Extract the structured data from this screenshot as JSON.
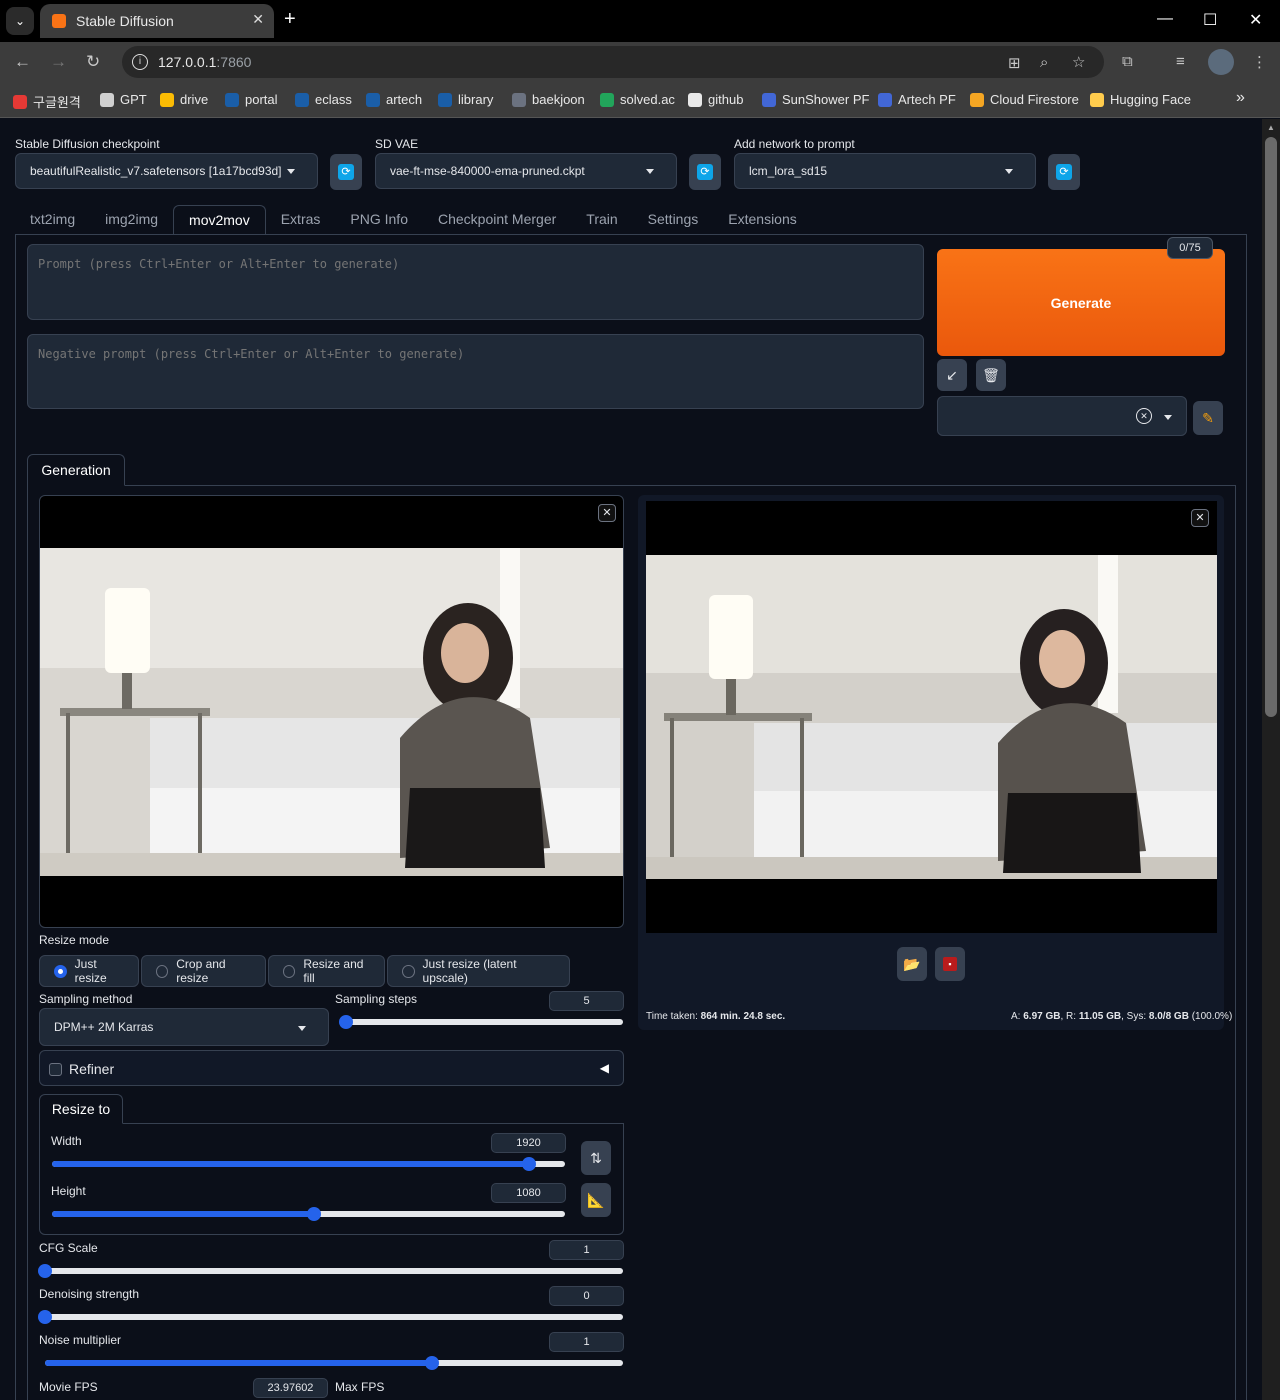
{
  "browser": {
    "tab_title": "Stable Diffusion",
    "url_host": "127.0.0.1",
    "url_port": ":7860",
    "bookmarks": [
      "구글원격",
      "GPT",
      "drive",
      "portal",
      "eclass",
      "artech",
      "library",
      "baekjoon",
      "solved.ac",
      "github",
      "SunShower PF",
      "Artech PF",
      "Cloud Firestore",
      "Hugging Face"
    ],
    "bookmark_colors": [
      "#e53935",
      "#d0d0d0",
      "#fbbc04",
      "#1a5ea8",
      "#1a5ea8",
      "#1a5ea8",
      "#1a5ea8",
      "#6b7280",
      "#22a55b",
      "#e8e8e8",
      "#4267d6",
      "#4267d6",
      "#f5a623",
      "#ffcc4d"
    ]
  },
  "settings": {
    "checkpoint_label": "Stable Diffusion checkpoint",
    "checkpoint_value": "beautifulRealistic_v7.safetensors [1a17bcd93d]",
    "vae_label": "SD VAE",
    "vae_value": "vae-ft-mse-840000-ema-pruned.ckpt",
    "network_label": "Add network to prompt",
    "network_value": "lcm_lora_sd15"
  },
  "tabs": [
    "txt2img",
    "img2img",
    "mov2mov",
    "Extras",
    "PNG Info",
    "Checkpoint Merger",
    "Train",
    "Settings",
    "Extensions"
  ],
  "active_tab": "mov2mov",
  "prompt": {
    "placeholder": "Prompt (press Ctrl+Enter or Alt+Enter to generate)",
    "negative_placeholder": "Negative prompt (press Ctrl+Enter or Alt+Enter to generate)",
    "token_count": "0/75"
  },
  "generate_label": "Generate",
  "generation_tab": "Generation",
  "resize_mode": {
    "label": "Resize mode",
    "options": [
      "Just resize",
      "Crop and resize",
      "Resize and fill",
      "Just resize (latent upscale)"
    ],
    "selected": "Just resize"
  },
  "sampling": {
    "method_label": "Sampling method",
    "method_value": "DPM++ 2M Karras",
    "steps_label": "Sampling steps",
    "steps_value": "5",
    "steps_fraction": 0.02
  },
  "refiner_label": "Refiner",
  "resize_to_label": "Resize to",
  "width": {
    "label": "Width",
    "value": "1920",
    "fraction": 0.93
  },
  "height": {
    "label": "Height",
    "value": "1080",
    "fraction": 0.51
  },
  "cfg": {
    "label": "CFG Scale",
    "value": "1",
    "fraction": 0.0
  },
  "denoise": {
    "label": "Denoising strength",
    "value": "0",
    "fraction": 0.0
  },
  "noise": {
    "label": "Noise multiplier",
    "value": "1",
    "fraction": 0.67
  },
  "movie_fps": {
    "label": "Movie FPS",
    "value": "23.97602"
  },
  "max_fps_label": "Max FPS",
  "output": {
    "time_label": "Time taken:",
    "time_value": "864 min. 24.8 sec.",
    "a_label": "A:",
    "a_value": "6.97 GB",
    "r_label": "R:",
    "r_value": "11.05 GB",
    "sys_label": "Sys:",
    "sys_value": "8.0/8 GB",
    "sys_pct": "(100.0%)"
  }
}
